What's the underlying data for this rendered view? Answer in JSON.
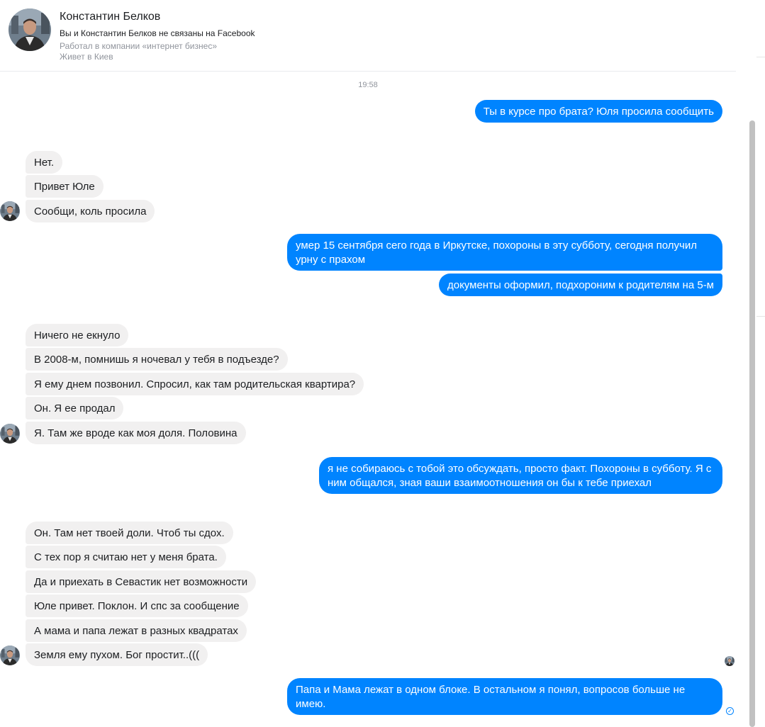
{
  "contact": {
    "name": "Константин Белков",
    "relation": "Вы и Константин Белков не связаны на Facebook",
    "work": "Работал в компании «интернет бизнес»",
    "city": "Живет в Киев"
  },
  "conversation": {
    "timestamp": "19:58",
    "messages": [
      {
        "dir": "out",
        "text": "Ты в курсе про брата? Юля просила сообщить"
      },
      {
        "dir": "in",
        "text": "Нет."
      },
      {
        "dir": "in",
        "text": "Привет Юле"
      },
      {
        "dir": "in",
        "text": "Сообщи, коль просила"
      },
      {
        "dir": "out",
        "text": "умер 15 сентября сего года в Иркутске, похороны в эту субботу, сегодня получил урну с прахом"
      },
      {
        "dir": "out",
        "text": "документы оформил, подхороним к родителям на 5-м"
      },
      {
        "dir": "in",
        "text": "Ничего не екнуло"
      },
      {
        "dir": "in",
        "text": "В 2008-м, помнишь я ночевал у тебя в подъезде?"
      },
      {
        "dir": "in",
        "text": "Я ему днем позвонил. Спросил, как там родительская квартира?"
      },
      {
        "dir": "in",
        "text": "Он. Я ее продал"
      },
      {
        "dir": "in",
        "text": "Я. Там же вроде как моя доля. Половина"
      },
      {
        "dir": "out",
        "text": "я не собираюсь с тобой это обсуждать, просто факт. Похороны в субботу. Я с ним общался, зная ваши взаимоотношения он бы к тебе приехал"
      },
      {
        "dir": "in",
        "text": "Он. Там нет твоей доли. Чтоб ты сдох."
      },
      {
        "dir": "in",
        "text": "С тех пор я считаю нет у меня брата."
      },
      {
        "dir": "in",
        "text": "Да и приехать в Севастик нет возможности"
      },
      {
        "dir": "in",
        "text": "Юле привет. Поклон. И спс за сообщение"
      },
      {
        "dir": "in",
        "text": "А мама и папа лежат в разных квадратах"
      },
      {
        "dir": "in",
        "text": "Земля ему пухом. Бог простит..((("
      },
      {
        "dir": "out",
        "text": "Папа и Мама лежат в одном блоке. В остальном я понял, вопросов больше не имею."
      }
    ]
  },
  "icons": {
    "header_avatar": "contact-avatar-photo",
    "message_avatar": "contact-mini-avatar",
    "seen_indicator": "seen-avatar-icon",
    "sent_indicator": "sent-check-icon"
  },
  "colors": {
    "outgoing_bubble": "#0084ff",
    "incoming_bubble": "#f1f0f0",
    "secondary_text": "#90949c"
  }
}
